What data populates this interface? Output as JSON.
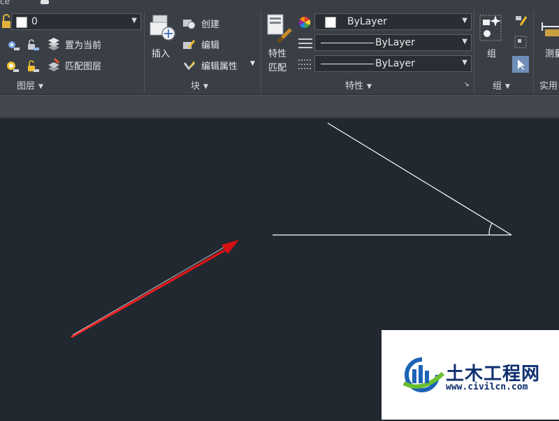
{
  "title_fragment": "ce",
  "layers": {
    "current_layer": "0",
    "set_current": "置为当前",
    "match_layer": "匹配图层",
    "panel_title": "图层"
  },
  "block": {
    "insert": "插入",
    "create": "创建",
    "edit": "编辑",
    "edit_attributes": "编辑属性",
    "panel_title": "块"
  },
  "properties": {
    "match_line1": "特性",
    "match_line2": "匹配",
    "color": "ByLayer",
    "linetype": "ByLayer",
    "lineweight": "ByLayer",
    "panel_title": "特性"
  },
  "group": {
    "label": "组",
    "panel_title": "组"
  },
  "utilities": {
    "measure": "测量",
    "panel_title": "实用"
  },
  "watermark": {
    "name": "土木工程网",
    "url": "www.civilcn.com"
  },
  "colors": {
    "canvas": "#212830",
    "ribbon": "#3a3f46",
    "arrow": "#e8191c",
    "lines": "#ffffff",
    "watermark_text": "#0f2f6e"
  }
}
